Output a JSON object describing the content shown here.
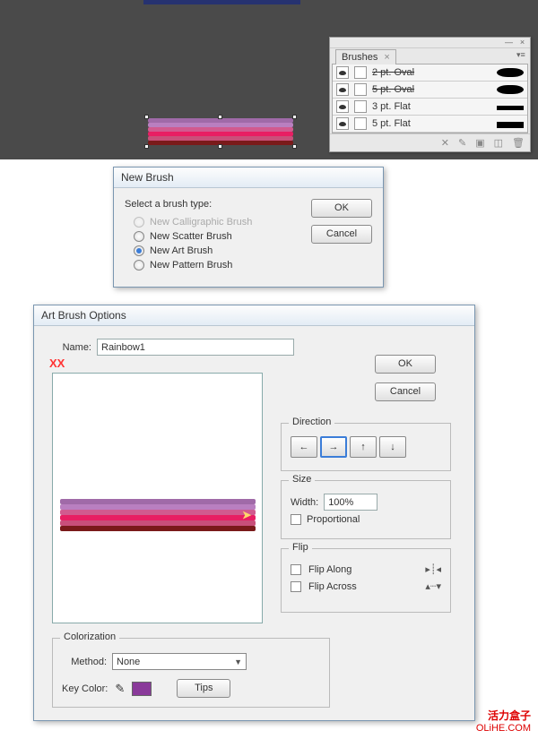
{
  "canvas": {
    "stripe_colors": [
      "#a06aa8",
      "#b97fc0",
      "#d15a8f",
      "#e81e63",
      "#c94f7a",
      "#7a1a1a"
    ]
  },
  "brushes_panel": {
    "title": "Brushes",
    "items": [
      {
        "name": "2 pt. Oval",
        "strike": true,
        "style": "oval"
      },
      {
        "name": "5 pt. Oval",
        "strike": true,
        "style": "oval"
      },
      {
        "name": "3 pt. Flat",
        "strike": false,
        "style": "flat"
      },
      {
        "name": "5 pt. Flat",
        "strike": false,
        "style": "flat"
      }
    ],
    "footer_icons": [
      "remove-link-icon",
      "new-library-icon",
      "new-brush-icon",
      "options-icon",
      "trash-icon"
    ]
  },
  "new_brush": {
    "title": "New Brush",
    "prompt": "Select a brush type:",
    "options": [
      {
        "label": "New Calligraphic Brush",
        "disabled": true,
        "selected": false
      },
      {
        "label": "New Scatter Brush",
        "disabled": false,
        "selected": false
      },
      {
        "label": "New Art Brush",
        "disabled": false,
        "selected": true
      },
      {
        "label": "New Pattern Brush",
        "disabled": false,
        "selected": false
      }
    ],
    "ok": "OK",
    "cancel": "Cancel"
  },
  "art_brush": {
    "title": "Art Brush Options",
    "name_label": "Name:",
    "name_value": "Rainbow1",
    "ok": "OK",
    "cancel": "Cancel",
    "direction": {
      "title": "Direction",
      "arrows": [
        "←",
        "→",
        "↑",
        "↓"
      ],
      "selected": 1
    },
    "size": {
      "title": "Size",
      "width_label": "Width:",
      "width_value": "100%",
      "proportional": "Proportional"
    },
    "flip": {
      "title": "Flip",
      "along": "Flip Along",
      "across": "Flip Across"
    },
    "colorization": {
      "title": "Colorization",
      "method_label": "Method:",
      "method_value": "None",
      "key_label": "Key Color:",
      "tips": "Tips"
    }
  },
  "annotation": {
    "xx": "XX"
  },
  "watermark": {
    "cn": "活力盒子",
    "en": "OLiHE.COM"
  }
}
